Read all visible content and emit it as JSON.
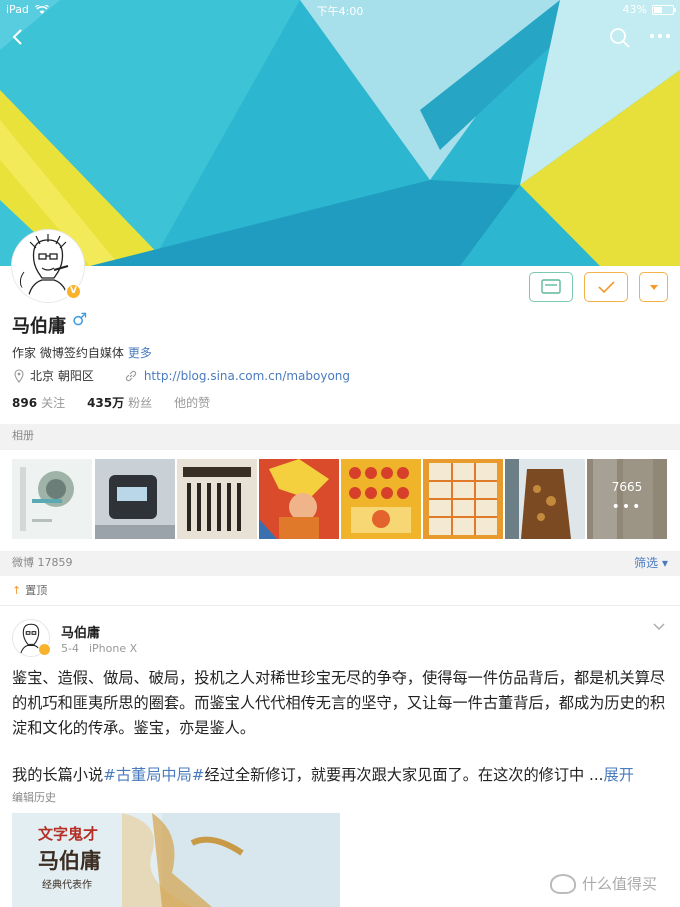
{
  "status_bar": {
    "device": "iPad",
    "time": "下午4:00",
    "battery": "43%",
    "battery_level": 0.43
  },
  "profile": {
    "name": "马伯庸",
    "gender_symbol": "♂",
    "bio": "作家 微博签约自媒体",
    "bio_more": "更多",
    "location": "北京 朝阳区",
    "url": "http://blog.sina.com.cn/maboyong",
    "follow_count": "896",
    "follow_label": "关注",
    "fans_count": "435万",
    "fans_label": "粉丝",
    "likes_label": "他的赞"
  },
  "album": {
    "title": "相册",
    "photo_count": "7665",
    "more_dots": "•••"
  },
  "weibo": {
    "label": "微博 17859",
    "filter": "筛选"
  },
  "pinned": {
    "label": "置顶"
  },
  "post": {
    "author": "马伯庸",
    "date": "5-4",
    "device": "iPhone X",
    "text": "鉴宝、造假、做局、破局，投机之人对稀世珍宝无尽的争夺，使得每一件仿品背后，都是机关算尽的机巧和匪夷所思的圈套。而鉴宝人代代相传无言的坚守，又让每一件古董背后，都成为历史的积淀和文化的传承。鉴宝，亦是鉴人。",
    "text2_prefix": "我的长篇小说",
    "hashtag": "#古董局中局#",
    "text2_suffix": "经过全新修订，就要再次跟大家见面了。在这次的修订中 ...",
    "expand": "展开",
    "edit_history": "编辑历史",
    "image_text_1": "文字鬼才",
    "image_text_2": "马伯庸",
    "image_text_3": "经典代表作"
  },
  "watermark": {
    "text": "什么值得买"
  },
  "colors": {
    "banner_teal": "#1eb4cf",
    "banner_yellow": "#efe43a",
    "link_blue": "#4a7bbf",
    "orange": "#f29a2e",
    "green_border": "#7cc8b1"
  }
}
